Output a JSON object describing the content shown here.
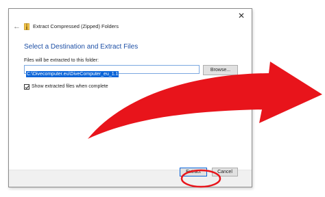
{
  "window": {
    "close_glyph": "✕",
    "back_glyph": "←",
    "title": "Extract Compressed (Zipped) Folders"
  },
  "main": {
    "heading": "Select a Destination and Extract Files",
    "destination_label": "Files will be extracted to this folder:",
    "destination_path": "C:\\Divecomputer.eu\\DiveComputer_eu_1.1",
    "browse_label": "Browse...",
    "show_files_label": "Show extracted files when complete",
    "show_files_checked": true
  },
  "footer": {
    "extract_label": "Extract",
    "cancel_label": "Cancel"
  },
  "annotation": {
    "arrow_color": "#e8141b",
    "circle_color": "#e8141b",
    "arrow_icon": "red-curved-arrow",
    "circle_target": "extract-button"
  }
}
